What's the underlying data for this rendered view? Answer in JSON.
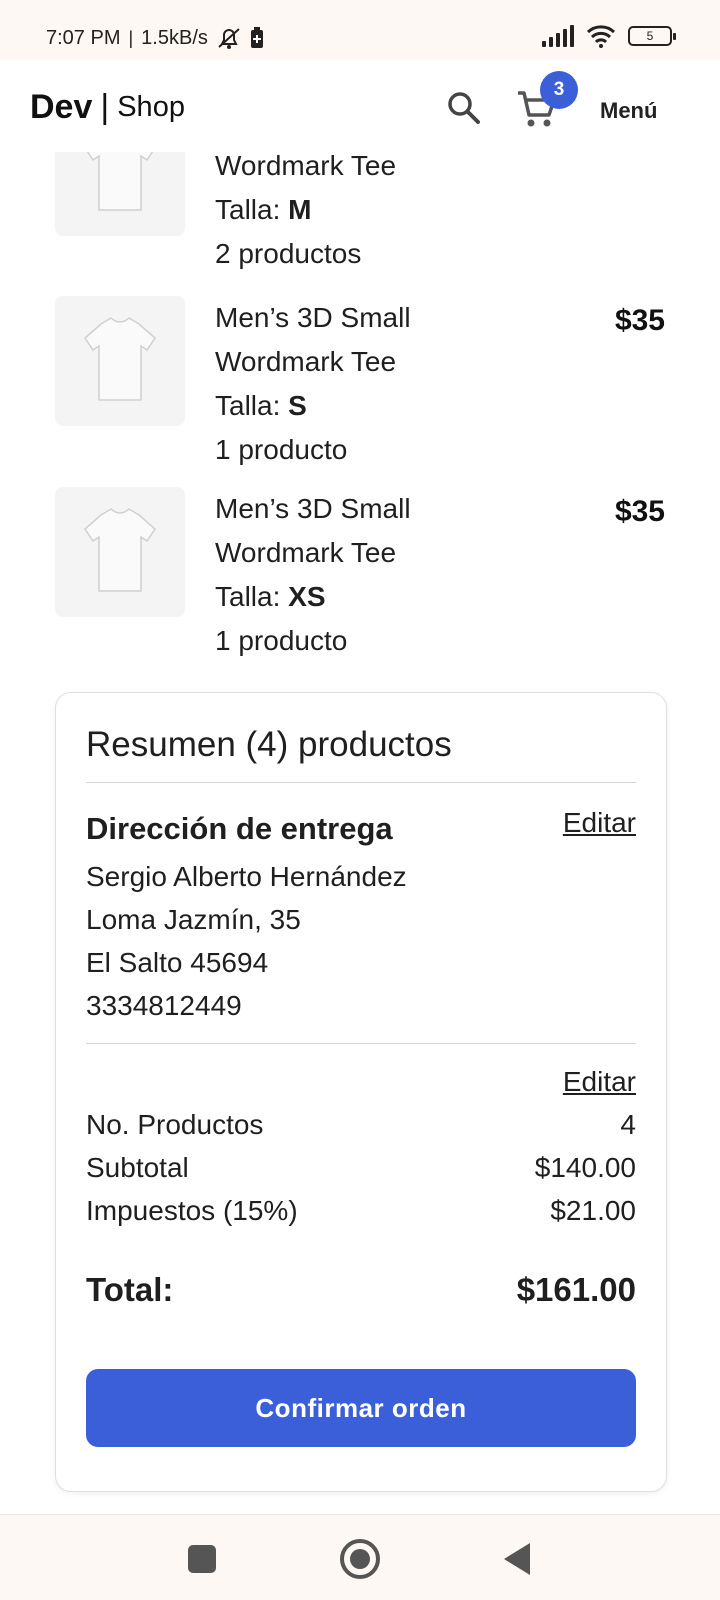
{
  "status_bar": {
    "time": "7:07 PM",
    "speed": "1.5kB/s",
    "battery": "5"
  },
  "nav": {
    "logo_bold": "Dev",
    "logo_separator": "|",
    "logo_light": "Shop",
    "cart_count": "3",
    "menu_label": "Menú"
  },
  "products": [
    {
      "name_line2": "Wordmark Tee",
      "size_label": "Talla:",
      "size": "M",
      "quantity": "2 productos",
      "price": ""
    },
    {
      "name_line1": "Men’s 3D Small",
      "name_line2": "Wordmark Tee",
      "size_label": "Talla:",
      "size": "S",
      "quantity": "1 producto",
      "price": "$35"
    },
    {
      "name_line1": "Men’s 3D Small",
      "name_line2": "Wordmark Tee",
      "size_label": "Talla:",
      "size": "XS",
      "quantity": "1 producto",
      "price": "$35"
    }
  ],
  "summary": {
    "title": "Resumen (4) productos",
    "address_heading": "Dirección de entrega",
    "edit_label": "Editar",
    "address": {
      "name": "Sergio Alberto Hernández",
      "street": "Loma Jazmín, 35",
      "city": "El Salto 45694",
      "phone": "3334812449"
    },
    "rows": {
      "count_label": "No. Productos",
      "count_value": "4",
      "subtotal_label": "Subtotal",
      "subtotal_value": "$140.00",
      "tax_label": "Impuestos (15%)",
      "tax_value": "$21.00",
      "total_label": "Total:",
      "total_value": "$161.00"
    },
    "confirm_label": "Confirmar orden"
  },
  "colors": {
    "accent": "#3b5fd9",
    "status_bar_bg": "#fdf8f3"
  },
  "icons": {
    "search": "search-icon",
    "cart": "cart-icon",
    "mute": "bell-off-icon",
    "wifi": "wifi-icon",
    "signal": "signal-icon"
  }
}
